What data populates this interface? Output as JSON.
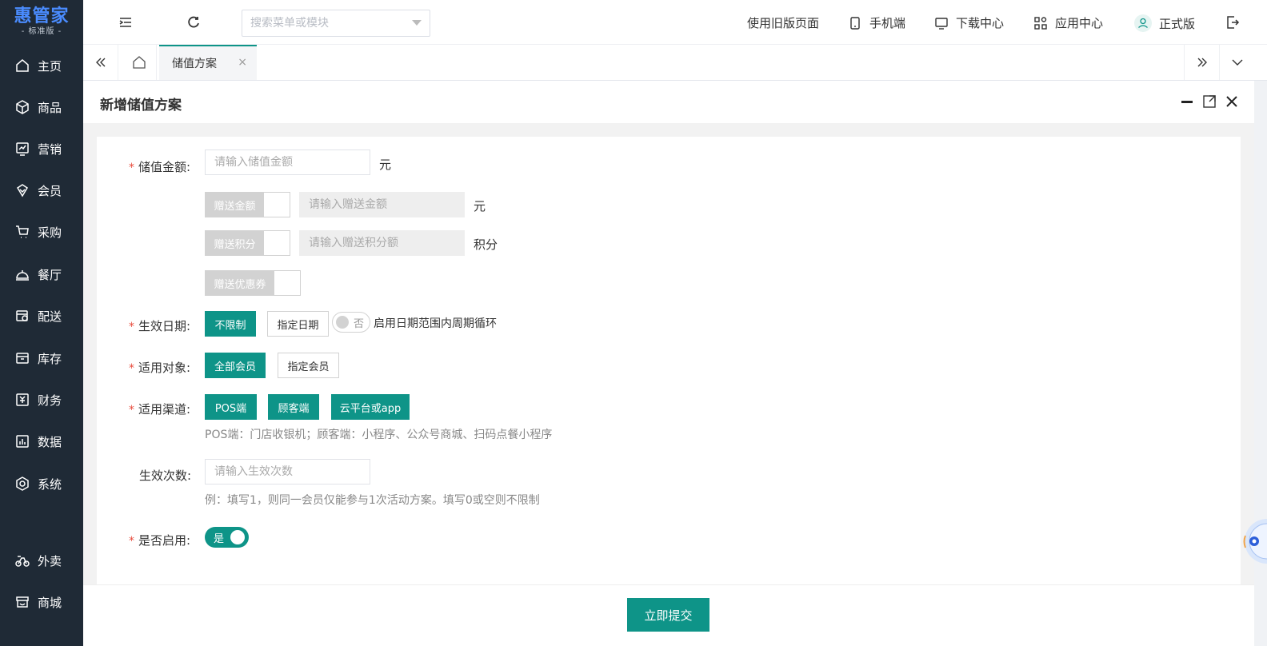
{
  "app": {
    "logo": "惠管家",
    "edition": "- 标准版 -"
  },
  "sidebar": {
    "items": [
      {
        "label": "主页",
        "icon": "home-icon"
      },
      {
        "label": "商品",
        "icon": "box-icon"
      },
      {
        "label": "营销",
        "icon": "trend-chart-icon"
      },
      {
        "label": "会员",
        "icon": "member-icon"
      },
      {
        "label": "采购",
        "icon": "cart-icon"
      },
      {
        "label": "餐厅",
        "icon": "service-bell-icon"
      },
      {
        "label": "配送",
        "icon": "delivery-icon"
      },
      {
        "label": "库存",
        "icon": "archive-icon"
      },
      {
        "label": "财务",
        "icon": "finance-icon"
      },
      {
        "label": "数据",
        "icon": "bar-chart-icon"
      },
      {
        "label": "系统",
        "icon": "settings-icon"
      },
      {
        "label": "外卖",
        "icon": "scooter-icon"
      },
      {
        "label": "商城",
        "icon": "shop-icon"
      }
    ]
  },
  "header": {
    "search_placeholder": "搜索菜单或模块",
    "old_page": "使用旧版页面",
    "mobile": "手机端",
    "download": "下载中心",
    "apps": "应用中心",
    "version": "正式版"
  },
  "tabs": {
    "active": "储值方案",
    "close": "×"
  },
  "panel": {
    "title": "新增储值方案"
  },
  "form": {
    "amount": {
      "label": "储值金额:",
      "placeholder": "请输入储值金额",
      "unit": "元"
    },
    "gift_amount": {
      "label": "赠送金额",
      "placeholder": "请输入赠送金额",
      "unit": "元"
    },
    "gift_points": {
      "label": "赠送积分",
      "placeholder": "请输入赠送积分额",
      "unit": "积分"
    },
    "gift_coupon": {
      "label": "赠送优惠券"
    },
    "effective_date": {
      "label": "生效日期:",
      "unlimited": "不限制",
      "specify": "指定日期",
      "cycle_switch": "否",
      "cycle_text": "启用日期范围内周期循环"
    },
    "target": {
      "label": "适用对象:",
      "all": "全部会员",
      "specify": "指定会员"
    },
    "channel": {
      "label": "适用渠道:",
      "pos": "POS端",
      "customer": "顾客端",
      "cloud": "云平台或app",
      "hint": "POS端：门店收银机；顾客端：小程序、公众号商城、扫码点餐小程序"
    },
    "times": {
      "label": "生效次数:",
      "placeholder": "请输入生效次数",
      "hint": "例：填写1，则同一会员仅能参与1次活动方案。填写0或空则不限制"
    },
    "enabled": {
      "label": "是否启用:",
      "value": "是"
    },
    "required_mark": "*"
  },
  "footer": {
    "submit": "立即提交"
  },
  "colors": {
    "primary": "#0e9488",
    "sidebar": "#1f2a36",
    "logo": "#4a8cff"
  }
}
